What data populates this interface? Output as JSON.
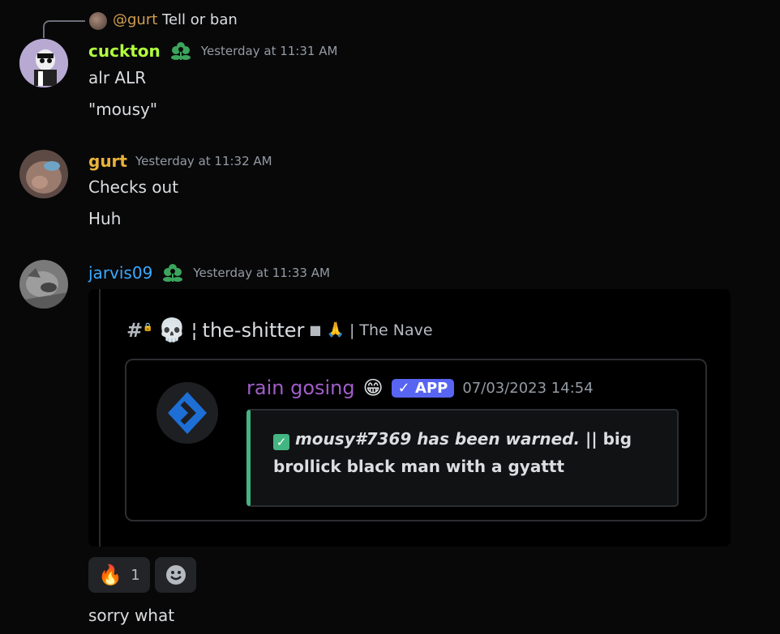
{
  "reply": {
    "mention": "@gurt",
    "text": "Tell or ban"
  },
  "messages": [
    {
      "username": "cuckton",
      "username_color": "#b2ff3d",
      "timestamp": "Yesterday at 11:31 AM",
      "lines": [
        "alr ALR",
        "\"mousy\""
      ]
    },
    {
      "username": "gurt",
      "username_color": "#e9b23b",
      "timestamp": "Yesterday at 11:32 AM",
      "lines": [
        "Checks out",
        "Huh"
      ]
    },
    {
      "username": "jarvis09",
      "username_color": "#3ba9ff",
      "timestamp": "Yesterday at 11:33 AM",
      "lines": [
        "sorry what"
      ]
    }
  ],
  "screenshot": {
    "channel_name": "the-shitter",
    "separator": "¦",
    "server": "| The Nave",
    "bot_name": "rain gosing",
    "bot_name_color": "#a05ec9",
    "app_badge": "APP",
    "bot_timestamp": "07/03/2023 14:54",
    "warn_text_italic": "mousy#7369 has been warned.",
    "warn_text_rest_1": "|| big",
    "warn_text_rest_2": "brollick black man with a gyattt"
  },
  "reactions": [
    {
      "emoji": "fire",
      "count": "1"
    }
  ],
  "colors": {
    "background": "#080809",
    "accent_blue": "#5865f2",
    "success_green": "#43b581"
  }
}
